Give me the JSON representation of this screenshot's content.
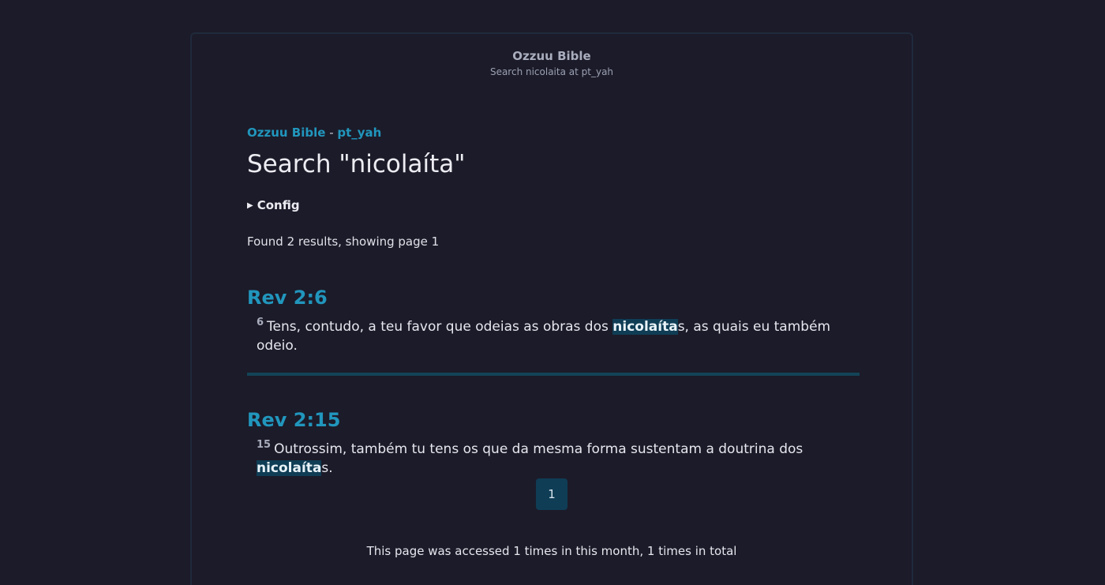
{
  "header": {
    "site_title": "Ozzuu Bible",
    "site_subtitle": "Search nicolaita at pt_yah"
  },
  "breadcrumb": {
    "home": "Ozzuu Bible",
    "separator": " - ",
    "version": "pt_yah"
  },
  "page_title": "Search \"nicolaíta\"",
  "config": {
    "label": "Config",
    "expanded": false
  },
  "results_summary": "Found 2 results, showing page 1",
  "results": [
    {
      "ref": "Rev 2:6",
      "verse_num": "6",
      "before": "Tens, contudo, a teu favor que odeias as obras dos ",
      "match": "nicolaíta",
      "after": "s, as quais eu também odeio."
    },
    {
      "ref": "Rev 2:15",
      "verse_num": "15",
      "before": "Outrossim, também tu tens os que da mesma forma sustentam a doutrina dos ",
      "match": "nicolaíta",
      "after": "s."
    }
  ],
  "pagination": {
    "current_page": "1"
  },
  "footer": {
    "access_note": "This page was accessed 1 times in this month, 1 times in total"
  },
  "colors": {
    "background": "#1c1b29",
    "accent": "#2196bd",
    "highlight": "#0f3d55"
  }
}
